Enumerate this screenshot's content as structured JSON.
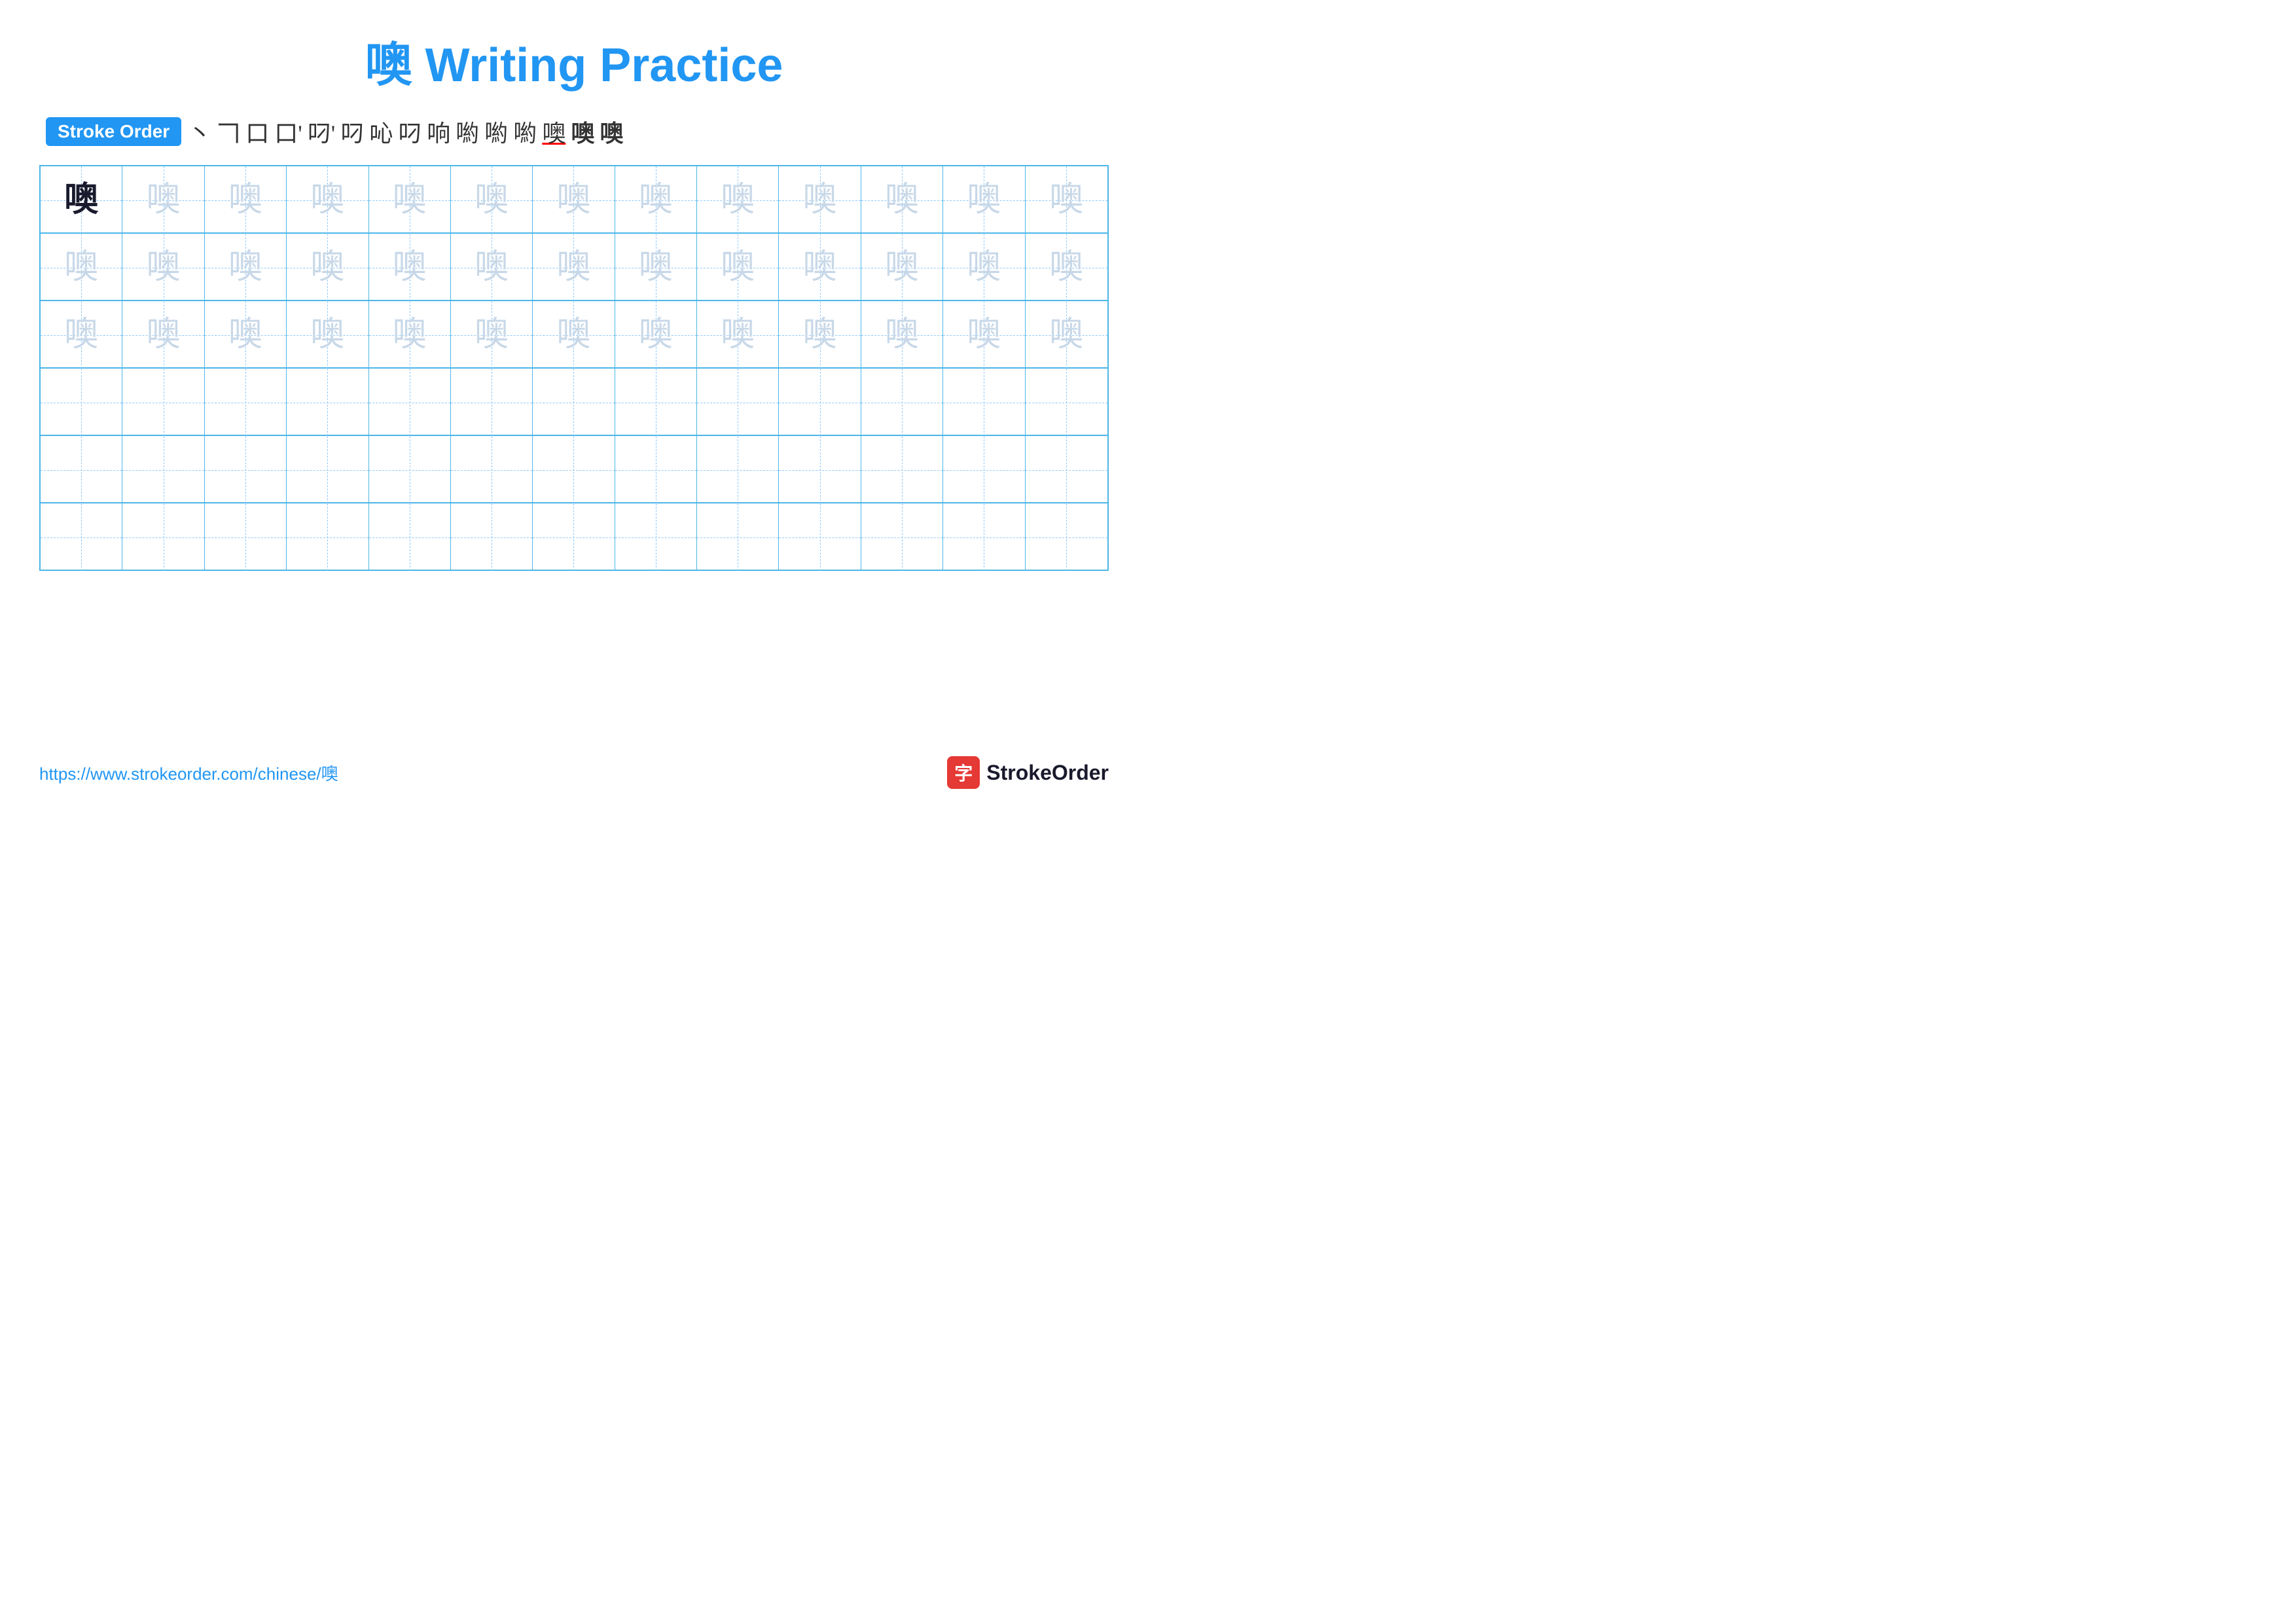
{
  "title": {
    "char": "噢",
    "rest": " Writing Practice"
  },
  "strokeOrder": {
    "badge": "Stroke Order",
    "strokes": [
      "丶",
      "𠃍",
      "口",
      "口'",
      "叼'",
      "叼",
      "叼",
      "叼",
      "叼",
      "喲",
      "喲",
      "喲",
      "喲",
      "噢",
      "噢"
    ]
  },
  "mainChar": "噢",
  "footer": {
    "url": "https://www.strokeorder.com/chinese/噢",
    "logoChar": "字",
    "logoText": "StrokeOrder"
  },
  "gridRows": 6,
  "gridCols": 13
}
